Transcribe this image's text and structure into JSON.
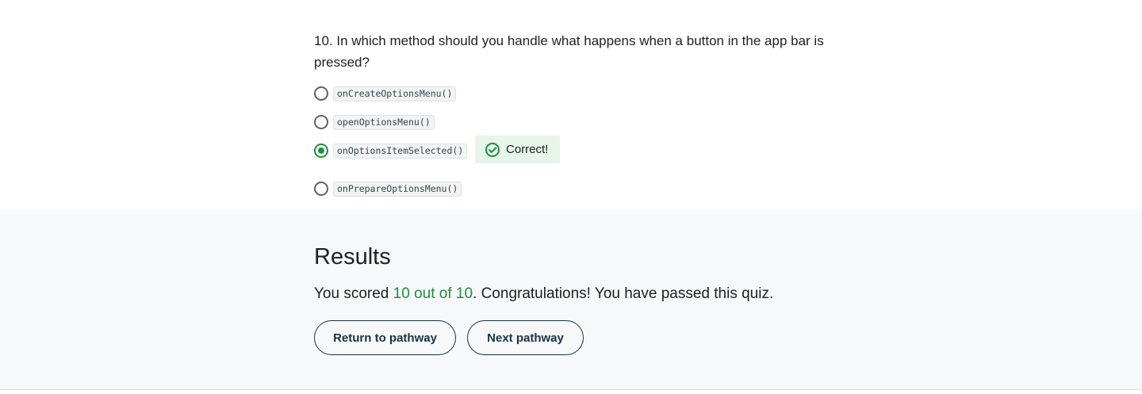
{
  "question": {
    "number": "10.",
    "text": "In which method should you handle what happens when a button in the app bar is pressed?",
    "options": [
      {
        "label": "onCreateOptionsMenu()",
        "selected": false
      },
      {
        "label": "openOptionsMenu()",
        "selected": false
      },
      {
        "label": "onOptionsItemSelected()",
        "selected": true
      },
      {
        "label": "onPrepareOptionsMenu()",
        "selected": false
      }
    ],
    "feedback": {
      "label": "Correct!",
      "icon": "check-circle-icon",
      "color": "#1e8e3e"
    }
  },
  "results": {
    "title": "Results",
    "score_prefix": "You scored ",
    "score": "10 out of 10",
    "score_suffix": ". Congratulations! You have passed this quiz.",
    "buttons": {
      "return_label": "Return to pathway",
      "next_label": "Next pathway"
    }
  },
  "colors": {
    "accent_green": "#1e8e3e",
    "feedback_bg": "#e6f4ea",
    "button_border": "#163343",
    "results_bg": "#f7f8f9"
  }
}
